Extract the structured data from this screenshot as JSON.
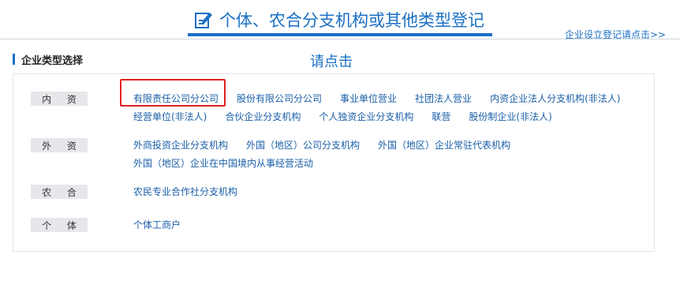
{
  "header": {
    "title": "个体、农合分支机构或其他类型登记",
    "link": "企业设立登记请点击>>"
  },
  "section": {
    "title": "企业类型选择",
    "hint": "请点击"
  },
  "categories": [
    {
      "label": "内 资",
      "items": [
        "有限责任公司分公司",
        "股份有限公司分公司",
        "事业单位营业",
        "社团法人营业",
        "内资企业法人分支机构(非法人)",
        "经营单位(非法人)",
        "合伙企业分支机构",
        "个人独资企业分支机构",
        "联营",
        "股份制企业(非法人)"
      ]
    },
    {
      "label": "外 资",
      "items": [
        "外商投资企业分支机构",
        "外国（地区）公司分支机构",
        "外国（地区）企业常驻代表机构",
        "外国（地区）企业在中国境内从事经营活动"
      ]
    },
    {
      "label": "农 合",
      "items": [
        "农民专业合作社分支机构"
      ]
    },
    {
      "label": "个 体",
      "items": [
        "个体工商户"
      ]
    }
  ],
  "colors": {
    "accent": "#1a6fc4",
    "link": "#1a5fa8",
    "highlight": "#e02020"
  }
}
